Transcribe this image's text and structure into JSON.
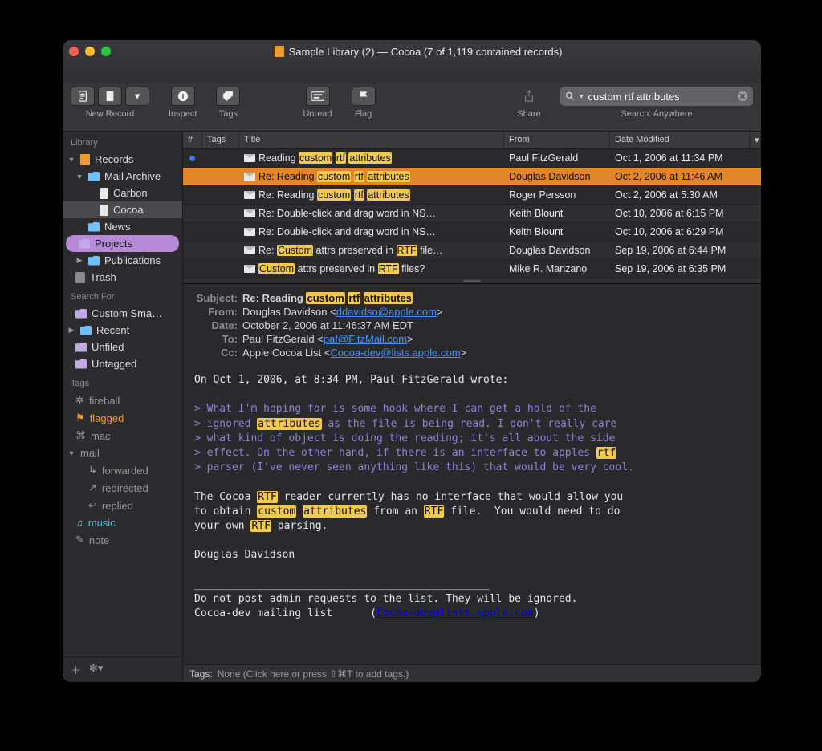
{
  "window": {
    "title": "Sample Library (2) — Cocoa (7 of 1,119 contained records)"
  },
  "toolbar": {
    "newrecord_label": "New Record",
    "inspect_label": "Inspect",
    "tags_label": "Tags",
    "unread_label": "Unread",
    "flag_label": "Flag",
    "share_label": "Share",
    "search_label": "Search: Anywhere",
    "search_value": "custom rtf attributes"
  },
  "sidebar": {
    "section_library": "Library",
    "section_searchfor": "Search For",
    "section_tags": "Tags",
    "records": "Records",
    "mail_archive": "Mail Archive",
    "carbon": "Carbon",
    "cocoa": "Cocoa",
    "news": "News",
    "projects": "Projects",
    "publications": "Publications",
    "trash": "Trash",
    "custom_smart": "Custom Sma…",
    "recent": "Recent",
    "unfiled": "Unfiled",
    "untagged": "Untagged",
    "tags": {
      "fireball": "fireball",
      "flagged": "flagged",
      "mac": "mac",
      "mail": "mail",
      "forwarded": "forwarded",
      "redirected": "redirected",
      "replied": "replied",
      "music": "music",
      "note": "note"
    }
  },
  "columns": {
    "num": "#",
    "tags": "Tags",
    "title": "Title",
    "from": "From",
    "date": "Date Modified"
  },
  "messages": [
    {
      "unread": true,
      "title": [
        "Reading ",
        " ",
        " "
      ],
      "hl": [
        "custom",
        "rtf",
        "attributes"
      ],
      "plain": "Reading custom rtf attributes",
      "from": "Paul FitzGerald",
      "date": "Oct 1, 2006 at 11:34 PM",
      "sel": false
    },
    {
      "unread": false,
      "plain": "Re: Reading custom rtf attributes",
      "hl": [
        "custom",
        "rtf",
        "attributes"
      ],
      "from": "Douglas Davidson",
      "date": "Oct 2, 2006 at 11:46 AM",
      "sel": true
    },
    {
      "unread": false,
      "plain": "Re: Reading custom rtf attributes",
      "hl": [
        "custom",
        "rtf",
        "attributes"
      ],
      "from": "Roger Persson",
      "date": "Oct 2, 2006 at 5:30 AM",
      "sel": false
    },
    {
      "unread": false,
      "plain": "Re: Double-click and drag word in NS…",
      "hl": [],
      "from": "Keith Blount",
      "date": "Oct 10, 2006 at 6:15 PM",
      "sel": false
    },
    {
      "unread": false,
      "plain": "Re: Double-click and drag word in NS…",
      "hl": [],
      "from": "Keith Blount",
      "date": "Oct 10, 2006 at 6:29 PM",
      "sel": false
    },
    {
      "unread": false,
      "plain": "Re: Custom attrs preserved in RTF file…",
      "hl": [
        "Custom",
        "RTF"
      ],
      "from": "Douglas Davidson",
      "date": "Sep 19, 2006 at 6:44 PM",
      "sel": false
    },
    {
      "unread": false,
      "plain": "Custom attrs preserved in RTF files?",
      "hl": [
        "Custom",
        "RTF"
      ],
      "from": "Mike R. Manzano",
      "date": "Sep 19, 2006 at 6:35 PM",
      "sel": false
    }
  ],
  "preview": {
    "subject_label": "Subject:",
    "subject": "Re: Reading custom rtf attributes",
    "subject_hl": [
      "custom",
      "rtf",
      "attributes"
    ],
    "from_label": "From:",
    "from_name": "Douglas Davidson",
    "from_email": "ddavidso@apple.com",
    "date_label": "Date:",
    "date": "October 2, 2006 at 11:46:37 AM EDT",
    "to_label": "To:",
    "to_name": "Paul FitzGerald",
    "to_email": "paf@FitzMail.com",
    "cc_label": "Cc:",
    "cc_name": "Apple Cocoa List",
    "cc_email": "Cocoa-dev@lists.apple.com",
    "body_intro": "On Oct 1, 2006, at 8:34 PM, Paul FitzGerald wrote:",
    "q1": "> What I'm hoping for is some hook where I can get a hold of the",
    "q2a": "> ignored ",
    "q2_hl": "attributes",
    "q2b": " as the file is being read. I don't really care",
    "q3": "> what kind of object is doing the reading; it's all about the side",
    "q4a": "> effect. On the other hand, if there is an interface to apples ",
    "q4_hl": "rtf",
    "q5": "> parser (I've never seen anything like this) that would be very cool.",
    "p1a": "The Cocoa ",
    "p1_hl1": "RTF",
    "p1b": " reader currently has no interface that would allow you",
    "p2a": "to obtain ",
    "p2_hl1": "custom",
    "p2b": " ",
    "p2_hl2": "attributes",
    "p2c": " from an ",
    "p2_hl3": "RTF",
    "p2d": " file.  You would need to do",
    "p3a": "your own ",
    "p3_hl1": "RTF",
    "p3b": " parsing.",
    "sig": "Douglas Davidson",
    "rule": "_______________________________________________",
    "foot1": "Do not post admin requests to the list. They will be ignored.",
    "foot2a": "Cocoa-dev mailing list      (",
    "foot2_link": "Cocoa-dev@lists.apple.com",
    "foot2b": ")"
  },
  "tagsbar": {
    "label": "Tags:",
    "placeholder": "None (Click here or press ⇧⌘T to add tags.)"
  }
}
